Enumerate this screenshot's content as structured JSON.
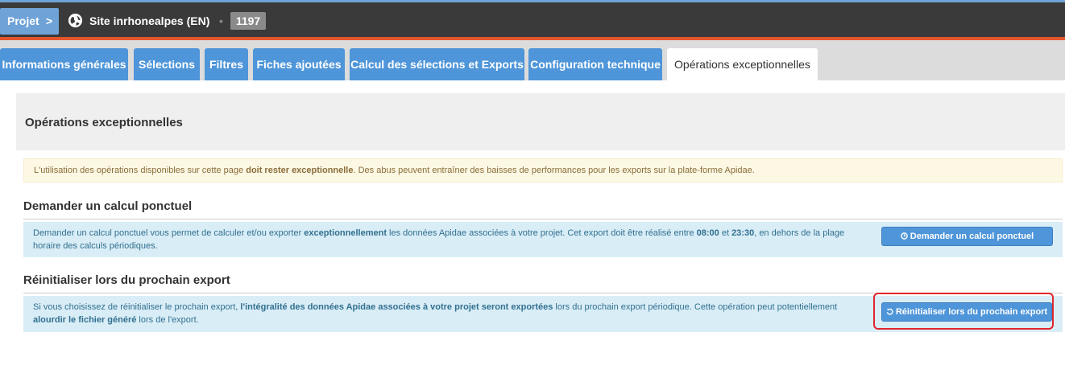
{
  "header": {
    "project_label": "Projet",
    "project_chevron": ">",
    "site_icon": "globe-icon",
    "site_name": "Site inrhonealpes (EN)",
    "separator": "•",
    "site_id": "1197"
  },
  "tabs": [
    {
      "label": "Informations générales",
      "active": false
    },
    {
      "label": "Sélections",
      "active": false
    },
    {
      "label": "Filtres",
      "active": false
    },
    {
      "label": "Fiches ajoutées",
      "active": false
    },
    {
      "label": "Calcul des sélections et Exports",
      "active": false
    },
    {
      "label": "Configuration technique",
      "active": false
    },
    {
      "label": "Opérations exceptionnelles",
      "active": true
    }
  ],
  "panel": {
    "title": "Opérations exceptionnelles"
  },
  "warning": {
    "text_before": "L'utilisation des opérations disponibles sur cette page ",
    "text_bold": "doit rester exceptionnelle",
    "text_after": ". Des abus peuvent entraîner des baisses de performances pour les exports sur la plate-forme Apidae."
  },
  "calcul_ponctuel": {
    "title": "Demander un calcul ponctuel",
    "t1": "Demander un calcul ponctuel vous permet de calculer et/ou exporter ",
    "b1": "exceptionnellement",
    "t2": " les données Apidae associées à votre projet. Cet export doit être réalisé entre ",
    "b2": "08:00",
    "t3": " et ",
    "b3": "23:30",
    "t4": ", en dehors de la plage horaire des calculs périodiques.",
    "button_label": "Demander un calcul ponctuel",
    "button_icon": "clock-icon"
  },
  "reinitialiser": {
    "title": "Réinitialiser lors du prochain export",
    "t1": "Si vous choisissez de réinitialiser le prochain export, ",
    "b1": "l'intégralité des données Apidae associées à votre projet seront exportées",
    "t2": " lors du prochain export périodique. Cette opération peut potentiellement ",
    "b2": "alourdir le fichier généré",
    "t3": " lors de l'export.",
    "button_label": "Réinitialiser lors du prochain export",
    "button_icon": "refresh-icon"
  },
  "colors": {
    "accent": "#4e95d9",
    "header_bg": "#3a3a3a",
    "header_stripe": "#e4552b",
    "highlight": "#e0262d"
  }
}
